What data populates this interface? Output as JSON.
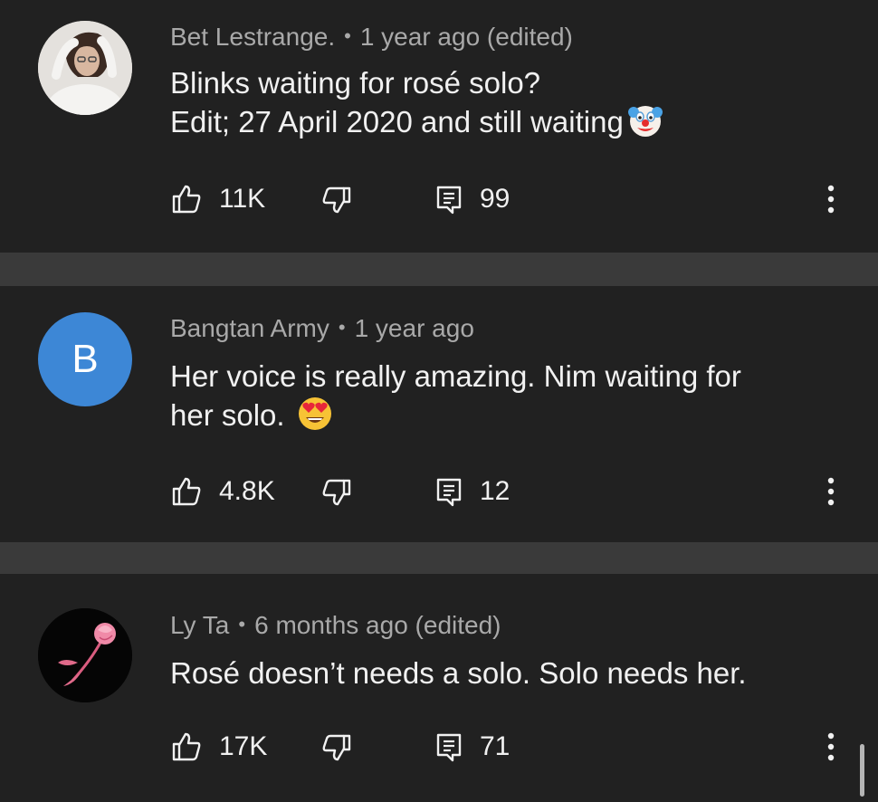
{
  "comments": [
    {
      "author": "Bet Lestrange.",
      "separator": "•",
      "time": "1 year ago (edited)",
      "lines": [
        "Blinks waiting for rosé solo?",
        "Edit; 27 April 2020 and still waiting"
      ],
      "emoji": "clown-face-icon",
      "likes": "11K",
      "replies": "99",
      "avatar": "photo"
    },
    {
      "author": "Bangtan Army",
      "separator": "•",
      "time": "1 year ago",
      "lines": [
        "Her voice is really amazing. Nim waiting for",
        "her solo."
      ],
      "emoji": "heart-eyes-icon",
      "likes": "4.8K",
      "replies": "12",
      "avatar_letter": "B",
      "avatar_color": "#3d87d6"
    },
    {
      "author": "Ly Ta",
      "separator": "•",
      "time": "6 months ago (edited)",
      "lines": [
        "Rosé doesn’t needs a solo. Solo needs her."
      ],
      "likes": "17K",
      "replies": "71",
      "avatar": "rose"
    }
  ],
  "colors": {
    "background": "#212121",
    "gap": "#3a3a3a",
    "meta_text": "#a9a9a9",
    "body_text": "#f1f1f1"
  }
}
